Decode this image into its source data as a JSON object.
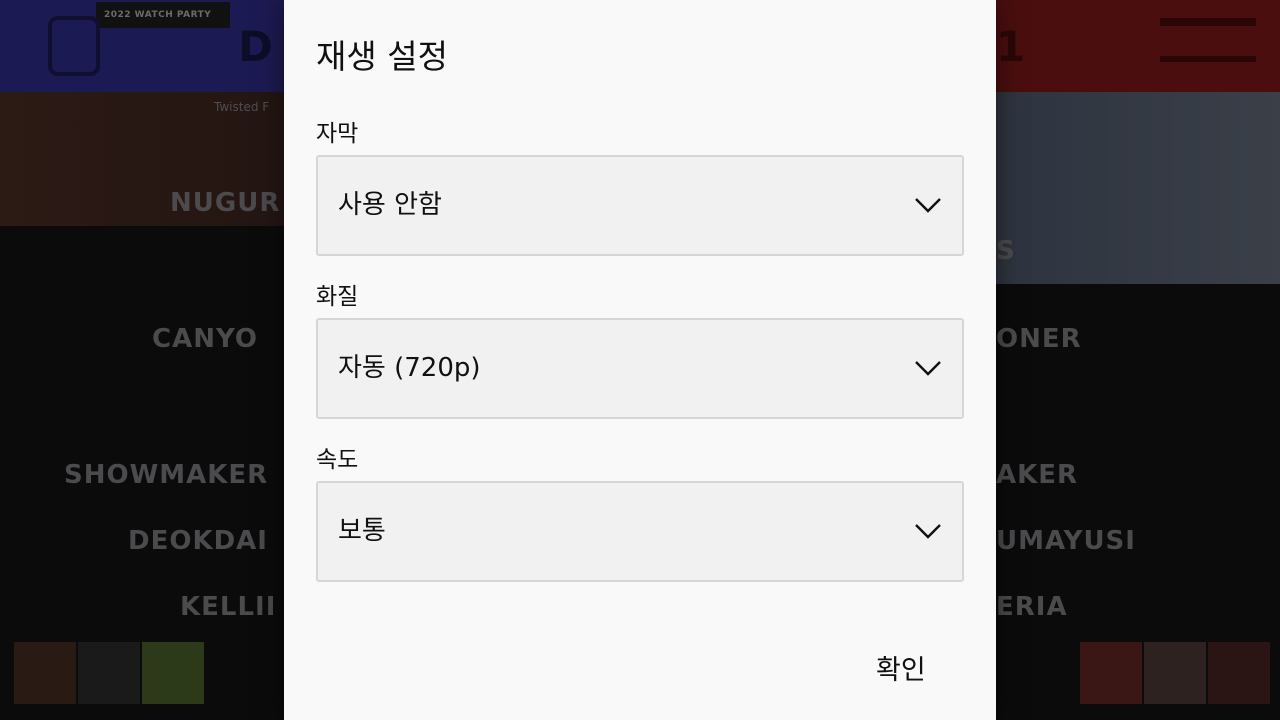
{
  "background": {
    "badge_text": "2022 WATCH PARTY",
    "score_left": "D",
    "score_right": "1",
    "subtitle": "Twisted F",
    "left_names": [
      "NUGUR",
      "CANYO",
      "SHOWMAKER",
      "DEOKDAI",
      "KELLII"
    ],
    "right_names": [
      "S",
      "ONER",
      "AKER",
      "UMAYUSI",
      "ERIA"
    ],
    "colors": {
      "top_left": "#1c1a52",
      "top_right": "#4a0e0e"
    }
  },
  "dialog": {
    "title": "재생 설정",
    "fields": [
      {
        "label": "자막",
        "value": "사용 안함"
      },
      {
        "label": "화질",
        "value": "자동 (720p)"
      },
      {
        "label": "속도",
        "value": "보통"
      }
    ],
    "confirm_label": "확인"
  }
}
